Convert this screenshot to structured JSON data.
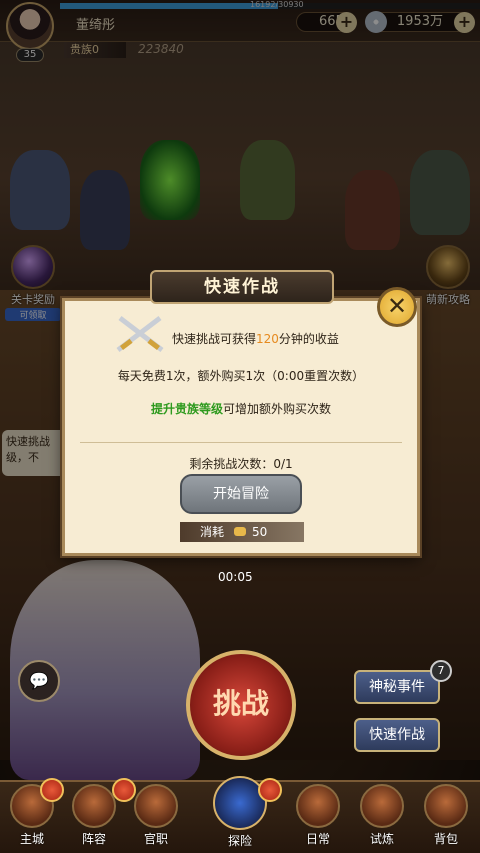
{
  "player": {
    "name": "董绮彤",
    "level": "35",
    "exp_text": "16192/30930",
    "exp_fraction": 0.52,
    "vip_label": "贵族0",
    "power": "223840"
  },
  "resources": {
    "silver": "665",
    "gold": "1953万"
  },
  "side": {
    "left_label": "关卡奖励",
    "left_sub": "可领取",
    "right_label": "萌新攻略",
    "chat_text": "快速挑战级，不"
  },
  "modal": {
    "title": "快速作战",
    "line1_pre": "快速挑战可获得",
    "line1_num": "120",
    "line1_post": "分钟的收益",
    "line2": "每天免费1次，额外购买1次（0:00重置次数）",
    "line3_green": "提升贵族等级",
    "line3_rest": "可增加额外购买次数",
    "remaining": "剩余挑战次数：0/1",
    "start_button": "开始冒险",
    "cost_label": "消耗",
    "cost_value": "50"
  },
  "hud": {
    "timer": "00:05",
    "mystery_event": "神秘事件",
    "quick_battle": "快速作战",
    "mystery_badge": "7",
    "challenge": "挑战"
  },
  "nav": {
    "items": [
      "主城",
      "阵容",
      "官职",
      "探险",
      "日常",
      "试炼",
      "背包"
    ]
  }
}
